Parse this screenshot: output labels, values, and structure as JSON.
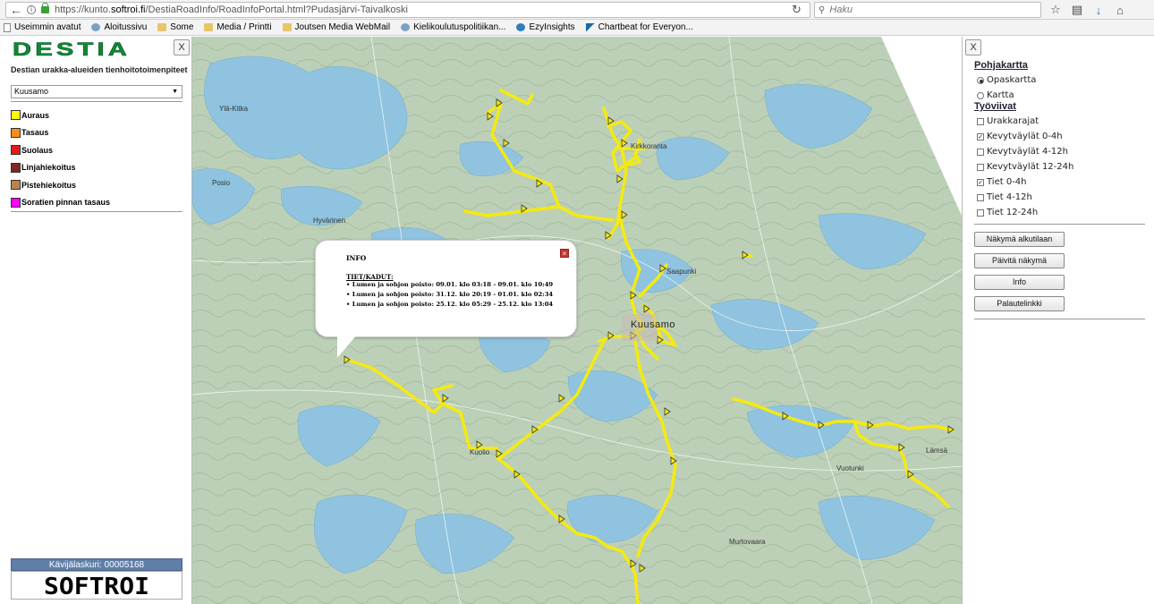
{
  "browser": {
    "url_prefix": "https://kunto.",
    "url_host": "softroi.fi",
    "url_path": "/DestiaRoadInfo/RoadInfoPortal.html?Pudasjärvi-Taivalkoski",
    "search_placeholder": "Haku"
  },
  "bookmarks": [
    {
      "label": "Useimmin avatut",
      "icon": "page"
    },
    {
      "label": "Aloitussivu",
      "icon": "globe"
    },
    {
      "label": "Some",
      "icon": "folder"
    },
    {
      "label": "Media / Printti",
      "icon": "folder"
    },
    {
      "label": "Joutsen Media WebMail",
      "icon": "folder"
    },
    {
      "label": "Kielikoulutuspolitiikan...",
      "icon": "globe"
    },
    {
      "label": "EzyInsights",
      "icon": "blue"
    },
    {
      "label": "Chartbeat for Everyon...",
      "icon": "chart"
    }
  ],
  "left": {
    "logo_text": "DESTIA",
    "close": "X",
    "title": "Destian urakka-alueiden tienhoitotoimenpiteet",
    "region": "Kuusamo",
    "legend": [
      {
        "label": "Auraus",
        "color": "#ffff00"
      },
      {
        "label": "Tasaus",
        "color": "#ff8c1a"
      },
      {
        "label": "Suolaus",
        "color": "#e31a1c"
      },
      {
        "label": "Linjahiekoitus",
        "color": "#7b2b22"
      },
      {
        "label": "Pistehiekoitus",
        "color": "#b8864b"
      },
      {
        "label": "Soratien pinnan tasaus",
        "color": "#ff00ff"
      }
    ],
    "counter_label": "Kävijälaskuri:",
    "counter_value": "00005168",
    "vendor_logo": "SOFTROI"
  },
  "map": {
    "places": [
      "Ylä-Kitka",
      "Posio",
      "Hyvärinen",
      "Kuusamo",
      "Kuolio",
      "Kirkkoranta",
      "Saapunki",
      "Lämsä",
      "Vuotunki",
      "Murtovaara"
    ]
  },
  "popup": {
    "title": "INFO",
    "subtitle": "TIET/KADUT:",
    "items": [
      "• Lumen ja sohjon poisto: 09.01. klo 03:18 - 09.01. klo 10:49",
      "• Lumen ja sohjon poisto: 31.12. klo 20:19 - 01.01. klo 02:34",
      "• Lumen ja sohjon poisto: 25.12. klo 05:29 - 25.12. klo 13:04"
    ],
    "close": "×"
  },
  "right": {
    "close": "X",
    "basemap_heading": "Pohjakartta",
    "basemap_options": [
      {
        "label": "Opaskartta",
        "selected": true
      },
      {
        "label": "Kartta",
        "selected": false
      }
    ],
    "worklines_heading": "Työviivat",
    "worklines": [
      {
        "label": "Urakkarajat",
        "checked": false
      },
      {
        "label": "Kevytväylät 0-4h",
        "checked": true
      },
      {
        "label": "Kevytväylät 4-12h",
        "checked": false
      },
      {
        "label": "Kevytväylät 12-24h",
        "checked": false
      },
      {
        "label": "Tiet 0-4h",
        "checked": true
      },
      {
        "label": "Tiet 4-12h",
        "checked": false
      },
      {
        "label": "Tiet 12-24h",
        "checked": false
      }
    ],
    "buttons": [
      "Näkymä alkutilaan",
      "Päivitä näkymä",
      "Info",
      "Palautelinkki"
    ]
  }
}
